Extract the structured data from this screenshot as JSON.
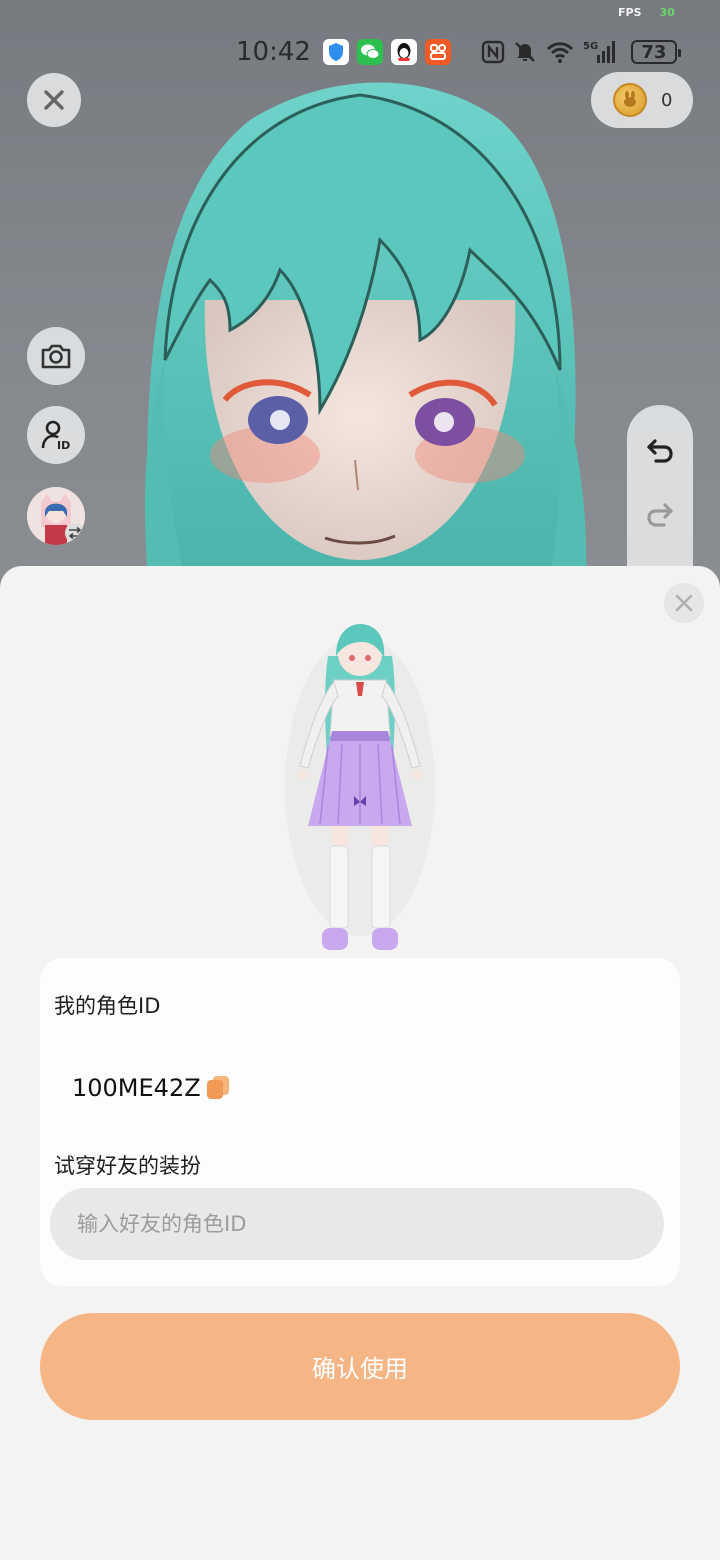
{
  "status_bar": {
    "fps_label": "FPS",
    "fps_value": "30",
    "time": "10:42",
    "battery": "73",
    "notification_icons": [
      "shield-app-icon",
      "wechat-icon",
      "qq-icon",
      "app-store-icon"
    ],
    "system_icons": [
      "nfc-icon",
      "mute-icon",
      "wifi-icon",
      "signal-5g-icon"
    ]
  },
  "top_bar": {
    "coin_count": "0"
  },
  "sheet": {
    "my_id_label": "我的角色ID",
    "my_id_value": "100ME42Z",
    "try_friend_label": "试穿好友的装扮",
    "friend_id_placeholder": "输入好友的角色ID",
    "confirm_label": "确认使用"
  },
  "colors": {
    "accent_button": "#f5b584",
    "copy_icon": "#f09a56",
    "fps_value": "#6cd46c"
  }
}
